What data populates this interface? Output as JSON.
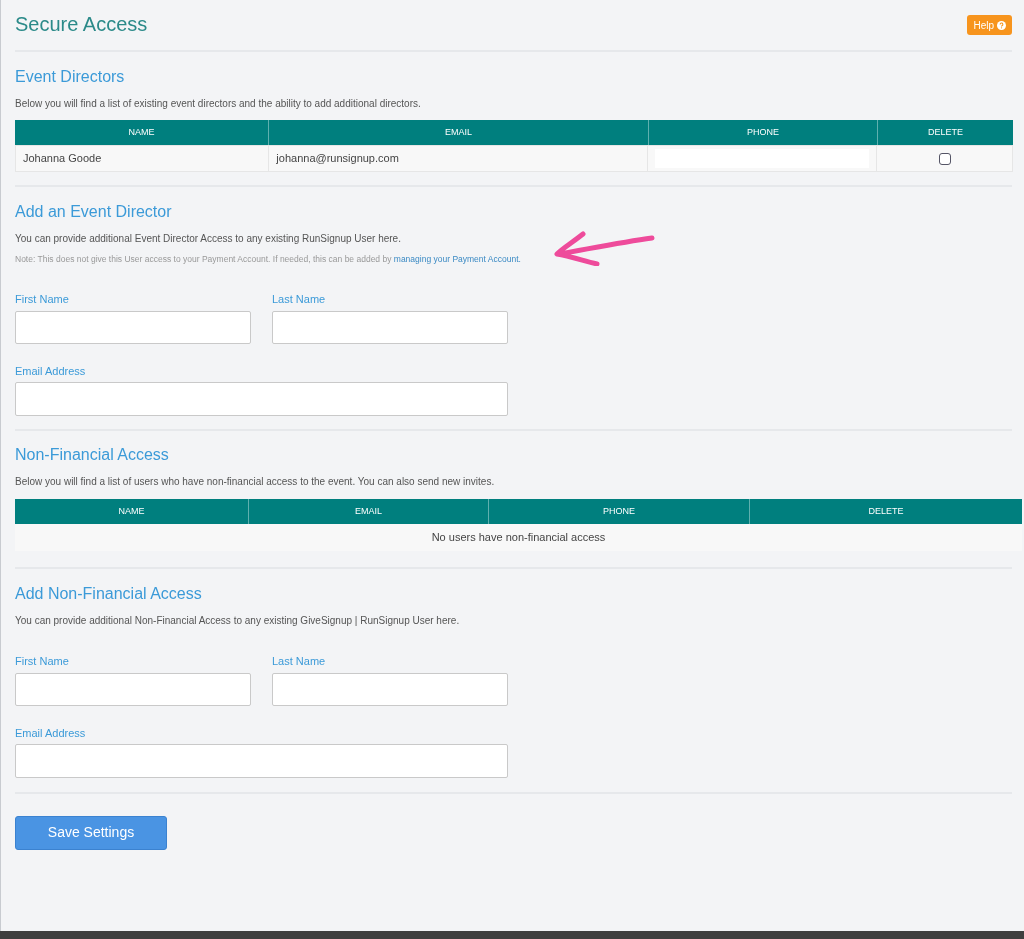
{
  "page_title": "Secure Access",
  "help_button": {
    "label": "Help"
  },
  "event_directors": {
    "heading": "Event Directors",
    "description": "Below you will find a list of existing event directors and the ability to add additional directors.",
    "columns": [
      "NAME",
      "EMAIL",
      "PHONE",
      "DELETE"
    ],
    "rows": [
      {
        "name": "Johanna Goode",
        "email": "johanna@runsignup.com",
        "delete_checked": false
      }
    ]
  },
  "add_event_director": {
    "heading": "Add an Event Director",
    "description": "You can provide additional Event Director Access to any existing RunSignup User here.",
    "note": "Note: This does not give this User access to your Payment Account. If needed, this can be added by",
    "note_link": "managing your Payment Account.",
    "fields": [
      {
        "label": "First Name"
      },
      {
        "label": "Last Name"
      },
      {
        "label": "Email Address"
      }
    ]
  },
  "non_financial_access": {
    "heading": "Non-Financial Access",
    "description": "Below you will find a list of users who have non-financial access to the event. You can also send new invites.",
    "columns": [
      "NAME",
      "EMAIL",
      "PHONE",
      "DELETE"
    ],
    "empty_message": "No users have non-financial access"
  },
  "add_non_financial_access": {
    "heading": "Add Non-Financial Access",
    "description": "You can provide additional Non-Financial Access to any existing GiveSignup | RunSignup User here.",
    "fields": [
      {
        "label": "First Name"
      },
      {
        "label": "Last Name"
      },
      {
        "label": "Email Address"
      }
    ]
  },
  "save_button": {
    "label": "Save Settings"
  }
}
